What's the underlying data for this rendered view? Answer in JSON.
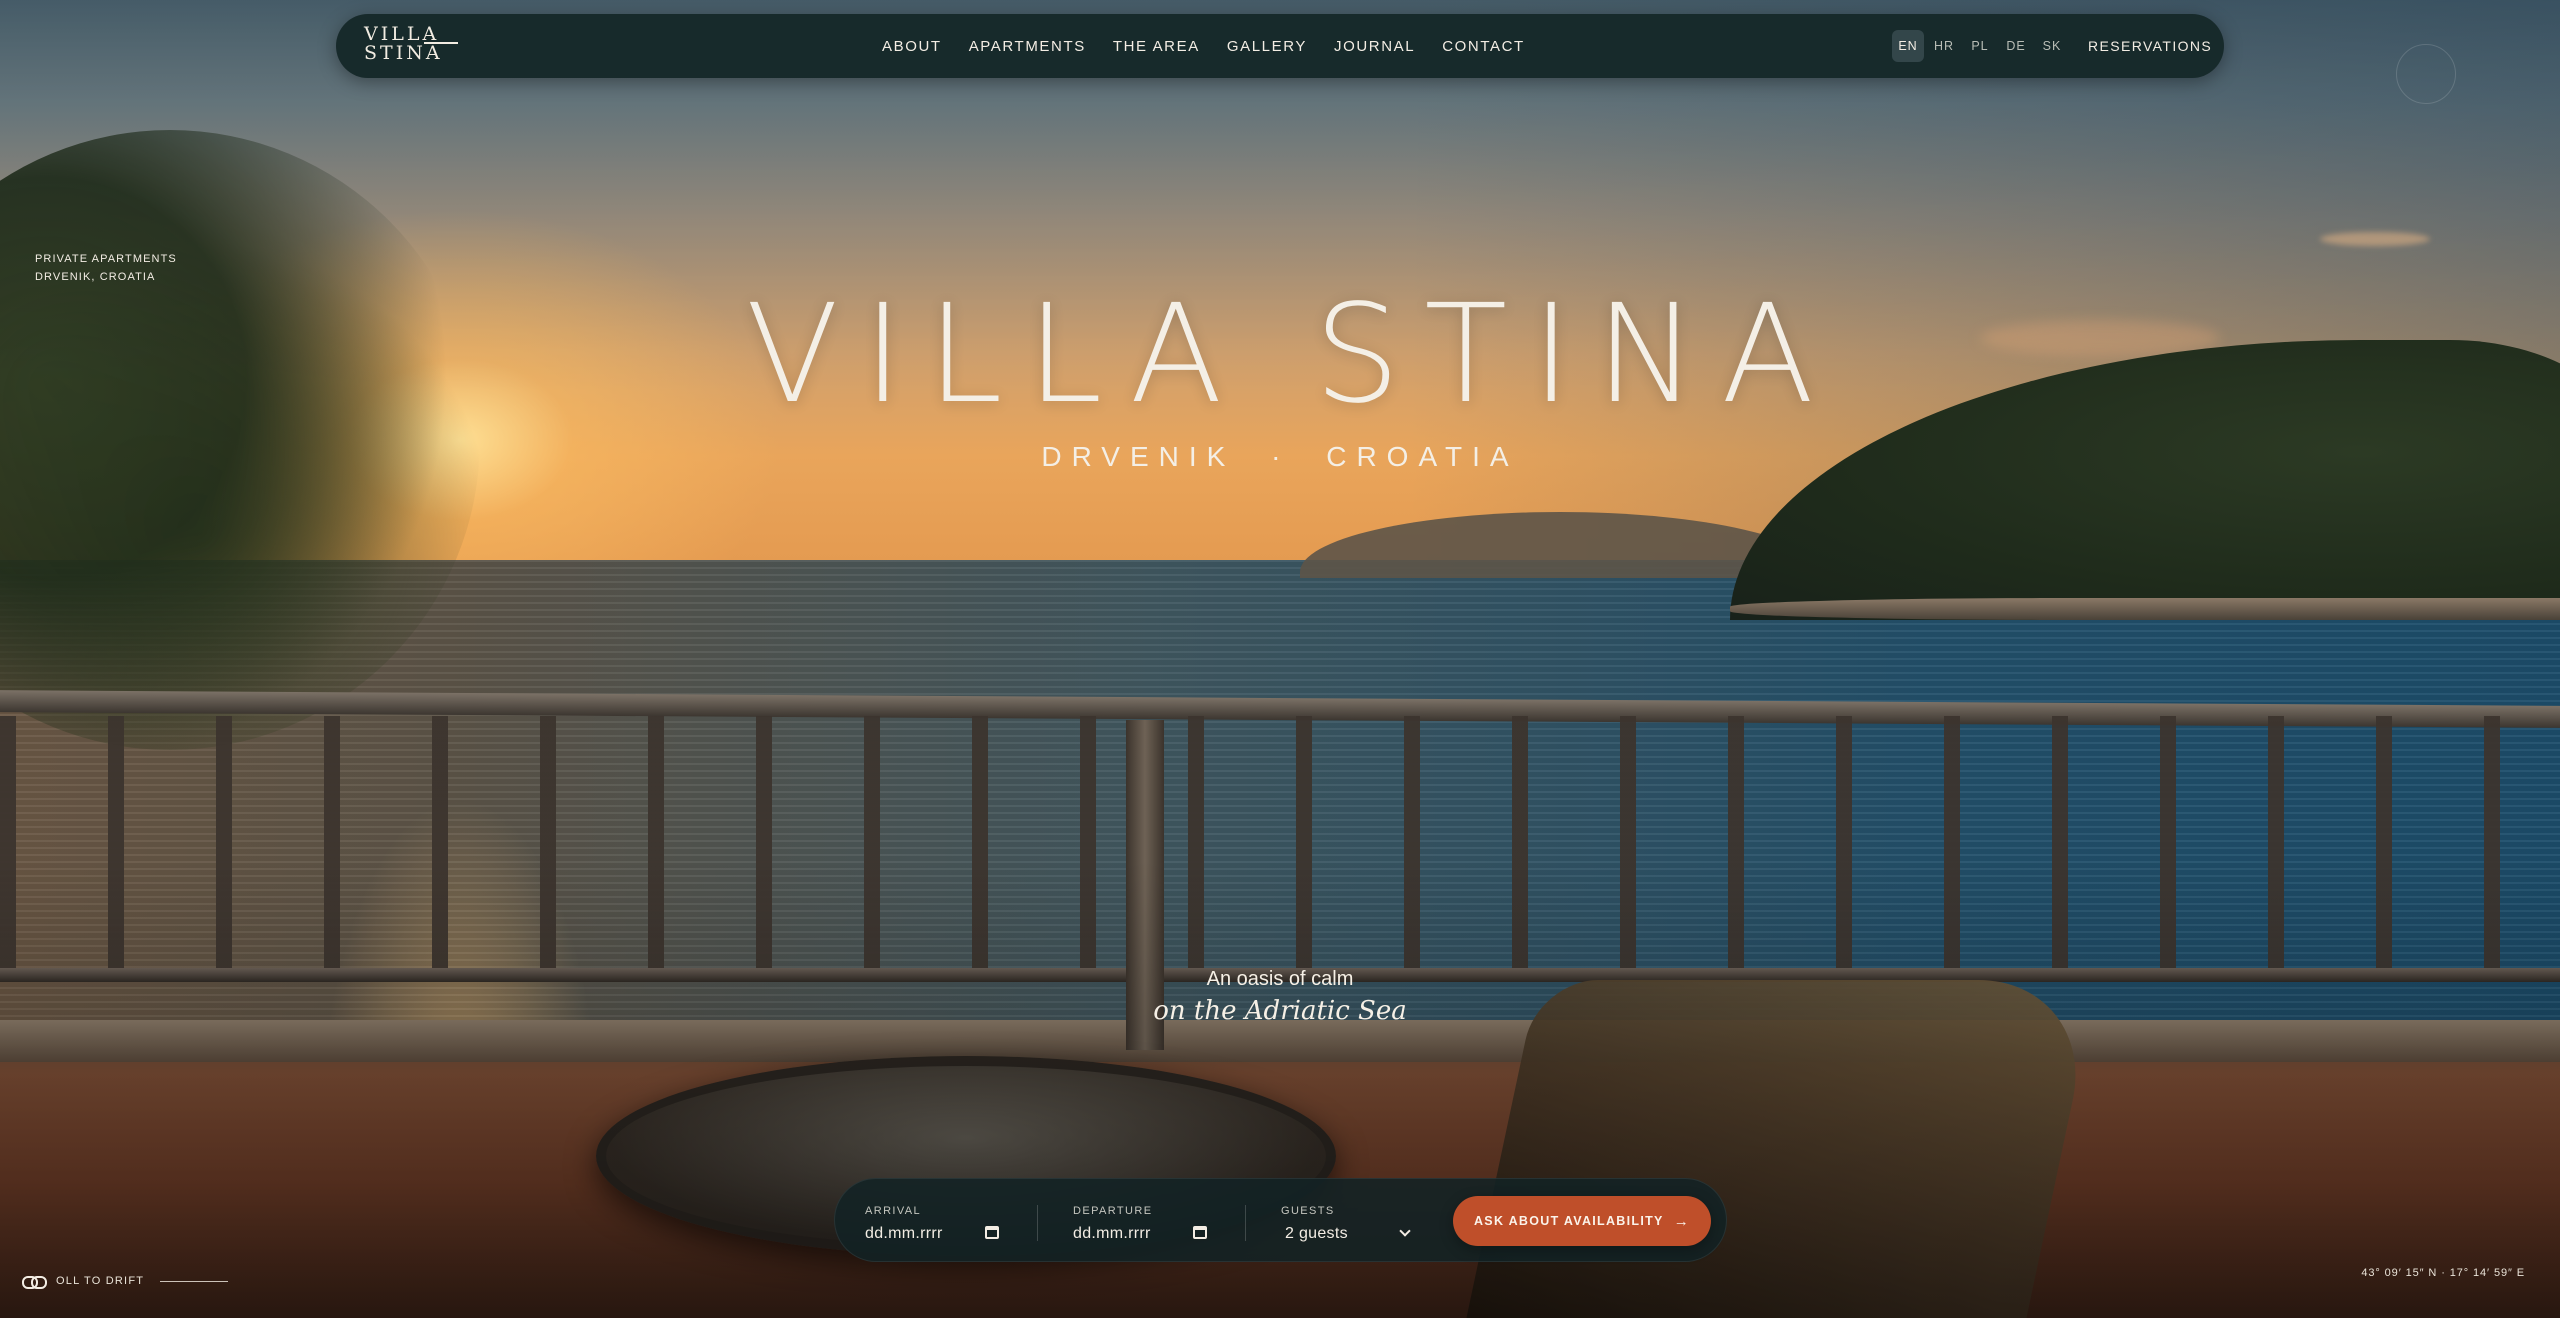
{
  "brand": {
    "logo_line1": "VILLA",
    "logo_line2": "STINA"
  },
  "nav": {
    "items": [
      {
        "label": "ABOUT"
      },
      {
        "label": "APARTMENTS"
      },
      {
        "label": "THE AREA"
      },
      {
        "label": "GALLERY"
      },
      {
        "label": "JOURNAL"
      },
      {
        "label": "CONTACT"
      }
    ],
    "languages": [
      "EN",
      "HR",
      "PL",
      "DE",
      "SK"
    ],
    "active_language": "EN",
    "reservations_label": "RESERVATIONS"
  },
  "side_info": {
    "line1": "PRIVATE APARTMENTS",
    "line2": "DRVENIK, CROATIA"
  },
  "hero": {
    "title": "VILLA STINA",
    "subtitle_left": "DRVENIK",
    "subtitle_sep": "·",
    "subtitle_right": "CROATIA",
    "tagline_line1": "An oasis of calm",
    "tagline_line2": "on the Adriatic Sea"
  },
  "booking": {
    "arrival_label": "ARRIVAL",
    "arrival_value": "dd.mm.rrrr",
    "departure_label": "DEPARTURE",
    "departure_value": "dd.mm.rrrr",
    "guests_label": "GUESTS",
    "guests_value": "2 guests",
    "cta_label": "ASK ABOUT AVAILABILITY",
    "cta_arrow": "→"
  },
  "footer": {
    "scroll_text": "OLL TO DRIFT",
    "coordinates": "43° 09′ 15″ N · 17° 14′ 59″ E"
  },
  "colors": {
    "nav_bg": "#172a2b",
    "accent": "#bf4f2a",
    "text": "#f3ede4"
  },
  "icons": [
    "calendar-icon",
    "chevron-down-icon",
    "arrow-right-icon",
    "scroll-link-icon"
  ]
}
